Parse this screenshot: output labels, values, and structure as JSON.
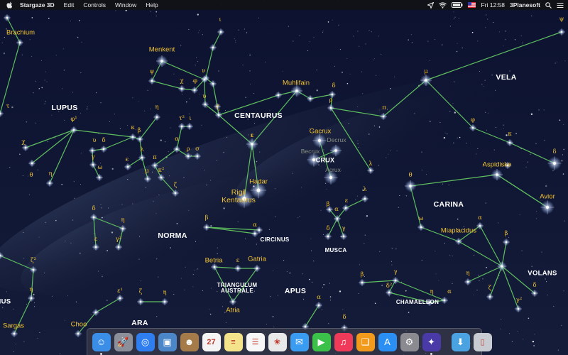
{
  "menubar": {
    "app_name": "Stargaze 3D",
    "menus": [
      "Edit",
      "Controls",
      "Window",
      "Help"
    ],
    "clock": "Fri 12:58",
    "vendor": "3Planesoft",
    "status_icons": [
      "location-icon",
      "wifi-icon",
      "battery-icon",
      "flag-icon",
      "search-icon",
      "list-icon"
    ]
  },
  "constellations": {
    "lupus": "LUPUS",
    "centaurus": "CENTAURUS",
    "crux": "CRUX",
    "vela": "VELA",
    "carina": "CARINA",
    "norma": "NORMA",
    "circinus": "CIRCINUS",
    "musca": "MUSCA",
    "triangulum_australe": "TRIANGULUM\nAUSTRALE",
    "apus": "APUS",
    "ara": "ARA",
    "chamaeleon": "CHAMAELEON",
    "volans": "VOLANS",
    "left_partial": "IUS"
  },
  "stars": {
    "brachium": "Brachium",
    "menkent": "Menkent",
    "muhlifain": "Muhlifain",
    "gacrux": "Gacrux",
    "hadar": "Hadar",
    "rigil": "Rigil\nKentaurus",
    "aspidiske": "Aspidiske",
    "avior": "Avior",
    "miaplacidus": "Miaplacidus",
    "betria": "Betria",
    "gatria": "Gatria",
    "atria": "Atria",
    "sargas": "Sargas",
    "choo": "Choo"
  },
  "faint_labels": {
    "becrux": "Becrux",
    "decrux": "Decrux",
    "acrux": "Acrux"
  },
  "greek_labels": [
    {
      "id": "iota-sco",
      "text": "ι"
    },
    {
      "id": "tau-lup",
      "text": "τ"
    },
    {
      "id": "phi1",
      "text": "φ¹"
    },
    {
      "id": "chi-lup",
      "text": "χ"
    },
    {
      "id": "theta-lup",
      "text": "θ"
    },
    {
      "id": "eta-lup",
      "text": "η"
    },
    {
      "id": "upsilon-lup",
      "text": "υ"
    },
    {
      "id": "delta-lup",
      "text": "δ"
    },
    {
      "id": "gamma-lup",
      "text": "γ"
    },
    {
      "id": "omega-lup",
      "text": "ω"
    },
    {
      "id": "kappa-lup",
      "text": "κ"
    },
    {
      "id": "beta-lup",
      "text": "β"
    },
    {
      "id": "lambda-lup",
      "text": "λ"
    },
    {
      "id": "epsilon-lup",
      "text": "ε"
    },
    {
      "id": "mu-lup",
      "text": "μ"
    },
    {
      "id": "eta-cen",
      "text": "η"
    },
    {
      "id": "tau-cen",
      "text": "τ²"
    },
    {
      "id": "iota-cen2",
      "text": "ι"
    },
    {
      "id": "alpha-lup",
      "text": "α"
    },
    {
      "id": "pi-lup",
      "text": "π"
    },
    {
      "id": "rho-lup",
      "text": "ρ"
    },
    {
      "id": "sigma-lup",
      "text": "σ"
    },
    {
      "id": "kappa2",
      "text": "κ²"
    },
    {
      "id": "zeta-lup",
      "text": "ζ"
    },
    {
      "id": "psi-cen",
      "text": "ψ"
    },
    {
      "id": "chi-cen",
      "text": "χ"
    },
    {
      "id": "phi-cen",
      "text": "φ"
    },
    {
      "id": "nu-cen",
      "text": "ν"
    },
    {
      "id": "upsilon-cen",
      "text": "υ"
    },
    {
      "id": "zeta-cen",
      "text": "ζ"
    },
    {
      "id": "iota-cen",
      "text": "ι"
    },
    {
      "id": "delta-cen",
      "text": "δ"
    },
    {
      "id": "rho-cen",
      "text": "ρ"
    },
    {
      "id": "pi-cen",
      "text": "π"
    },
    {
      "id": "epsilon-cen",
      "text": "ε"
    },
    {
      "id": "lambda-cen",
      "text": "λ"
    },
    {
      "id": "lambda-mus",
      "text": "λ"
    },
    {
      "id": "beta-mus",
      "text": "β"
    },
    {
      "id": "alpha-mus",
      "text": "α"
    },
    {
      "id": "epsilon-mus",
      "text": "ε"
    },
    {
      "id": "delta-mus",
      "text": "δ"
    },
    {
      "id": "gamma-mus",
      "text": "γ"
    },
    {
      "id": "mu-vel",
      "text": "μ"
    },
    {
      "id": "phi-vel",
      "text": "φ"
    },
    {
      "id": "kappa-vel",
      "text": "κ"
    },
    {
      "id": "delta-vel",
      "text": "δ"
    },
    {
      "id": "psi-vel",
      "text": "ψ"
    },
    {
      "id": "theta-car",
      "text": "θ"
    },
    {
      "id": "omega-car",
      "text": "ω"
    },
    {
      "id": "alpha-vol",
      "text": "α"
    },
    {
      "id": "beta-vol",
      "text": "β"
    },
    {
      "id": "eta-vol",
      "text": "η"
    },
    {
      "id": "zeta-vol",
      "text": "ζ"
    },
    {
      "id": "delta-vol",
      "text": "δ"
    },
    {
      "id": "gamma2-vol",
      "text": "γ²"
    },
    {
      "id": "eta-cha",
      "text": "η"
    },
    {
      "id": "gamma-cha",
      "text": "γ"
    },
    {
      "id": "beta-cha",
      "text": "β"
    },
    {
      "id": "delta2-cha",
      "text": "δ²"
    },
    {
      "id": "alpha-cha",
      "text": "α"
    },
    {
      "id": "delta-nor",
      "text": "δ"
    },
    {
      "id": "eta-nor",
      "text": "η"
    },
    {
      "id": "epsilon-nor",
      "text": "ε"
    },
    {
      "id": "gamma-nor",
      "text": "γ²"
    },
    {
      "id": "beta-cir",
      "text": "β"
    },
    {
      "id": "alpha-cir",
      "text": "α"
    },
    {
      "id": "epsilon-tra",
      "text": "ε"
    },
    {
      "id": "alpha-aps",
      "text": "α"
    },
    {
      "id": "delta-aps",
      "text": "δ"
    },
    {
      "id": "zeta-sco",
      "text": "ζ²"
    },
    {
      "id": "eta-sco",
      "text": "η"
    },
    {
      "id": "epsilon-ara",
      "text": "ε¹"
    },
    {
      "id": "zeta-ara",
      "text": "ζ"
    },
    {
      "id": "eta-ara",
      "text": "η"
    }
  ],
  "dock": {
    "apps": [
      {
        "name": "finder-icon",
        "glyph": "☺",
        "color": "#3b8ee8",
        "running": true
      },
      {
        "name": "launchpad-icon",
        "glyph": "🚀",
        "color": "#8a8f9a",
        "running": false
      },
      {
        "name": "safari-icon",
        "glyph": "◎",
        "color": "#2e7ef0",
        "running": false
      },
      {
        "name": "photo-preview-icon",
        "glyph": "▣",
        "color": "#4a86c8",
        "running": false
      },
      {
        "name": "contacts-icon",
        "glyph": "☻",
        "color": "#a57b4a",
        "running": false
      },
      {
        "name": "calendar-icon",
        "glyph": "27",
        "color": "#f4f4f4",
        "running": false
      },
      {
        "name": "notes-icon",
        "glyph": "≡",
        "color": "#f4e38a",
        "running": false
      },
      {
        "name": "reminders-icon",
        "glyph": "☰",
        "color": "#f7f7f7",
        "running": false
      },
      {
        "name": "photos-icon",
        "glyph": "❀",
        "color": "#e9e9e9",
        "running": false
      },
      {
        "name": "messages-icon",
        "glyph": "✉",
        "color": "#3a9cf0",
        "running": false
      },
      {
        "name": "facetime-icon",
        "glyph": "▶",
        "color": "#3bc04a",
        "running": false
      },
      {
        "name": "itunes-icon",
        "glyph": "♫",
        "color": "#ef3a5a",
        "running": false
      },
      {
        "name": "ibooks-icon",
        "glyph": "❑",
        "color": "#f29a1c",
        "running": false
      },
      {
        "name": "app-store-icon",
        "glyph": "A",
        "color": "#2a8ef2",
        "running": false
      },
      {
        "name": "system-preferences-icon",
        "glyph": "⚙",
        "color": "#8a8a90",
        "running": false
      },
      {
        "name": "stargaze-icon",
        "glyph": "✦",
        "color": "#4a3aa8",
        "running": true
      }
    ],
    "extras": [
      {
        "name": "downloads-folder-icon",
        "glyph": "⬇",
        "color": "#4aa2e0"
      },
      {
        "name": "trash-icon",
        "glyph": "▯",
        "color": "#c8ccd2"
      }
    ]
  },
  "colors": {
    "line": "#5fbf5f",
    "star_label": "#f2c230",
    "constellation_label": "#ffffff"
  }
}
